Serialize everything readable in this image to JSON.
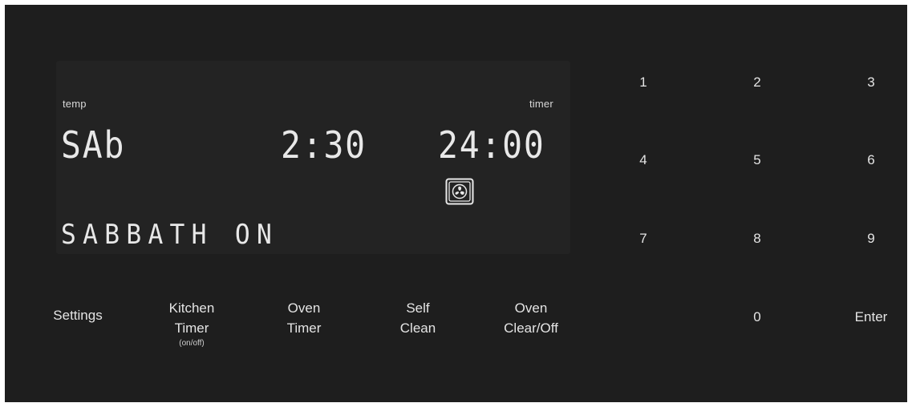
{
  "display": {
    "temp_label": "temp",
    "timer_label": "timer",
    "temp_value": "SAb",
    "cook_time": "2:30",
    "timer_value": "24:00",
    "message": "SABBATH ON",
    "fan_icon": "convection-fan-icon"
  },
  "keypad": {
    "digits": [
      "1",
      "2",
      "3",
      "4",
      "5",
      "6",
      "7",
      "8",
      "9",
      "0"
    ],
    "enter": "Enter"
  },
  "function_keys": {
    "settings": "Settings",
    "kitchen_timer_line1": "Kitchen",
    "kitchen_timer_line2": "Timer",
    "kitchen_timer_sub": "(on/off)",
    "oven_timer_line1": "Oven",
    "oven_timer_line2": "Timer",
    "self_clean_line1": "Self",
    "self_clean_line2": "Clean",
    "oven_clear_line1": "Oven",
    "oven_clear_line2": "Clear/Off"
  },
  "colors": {
    "panel": "#1e1e1e",
    "display": "#232323",
    "segment": "#e8e8e8"
  }
}
